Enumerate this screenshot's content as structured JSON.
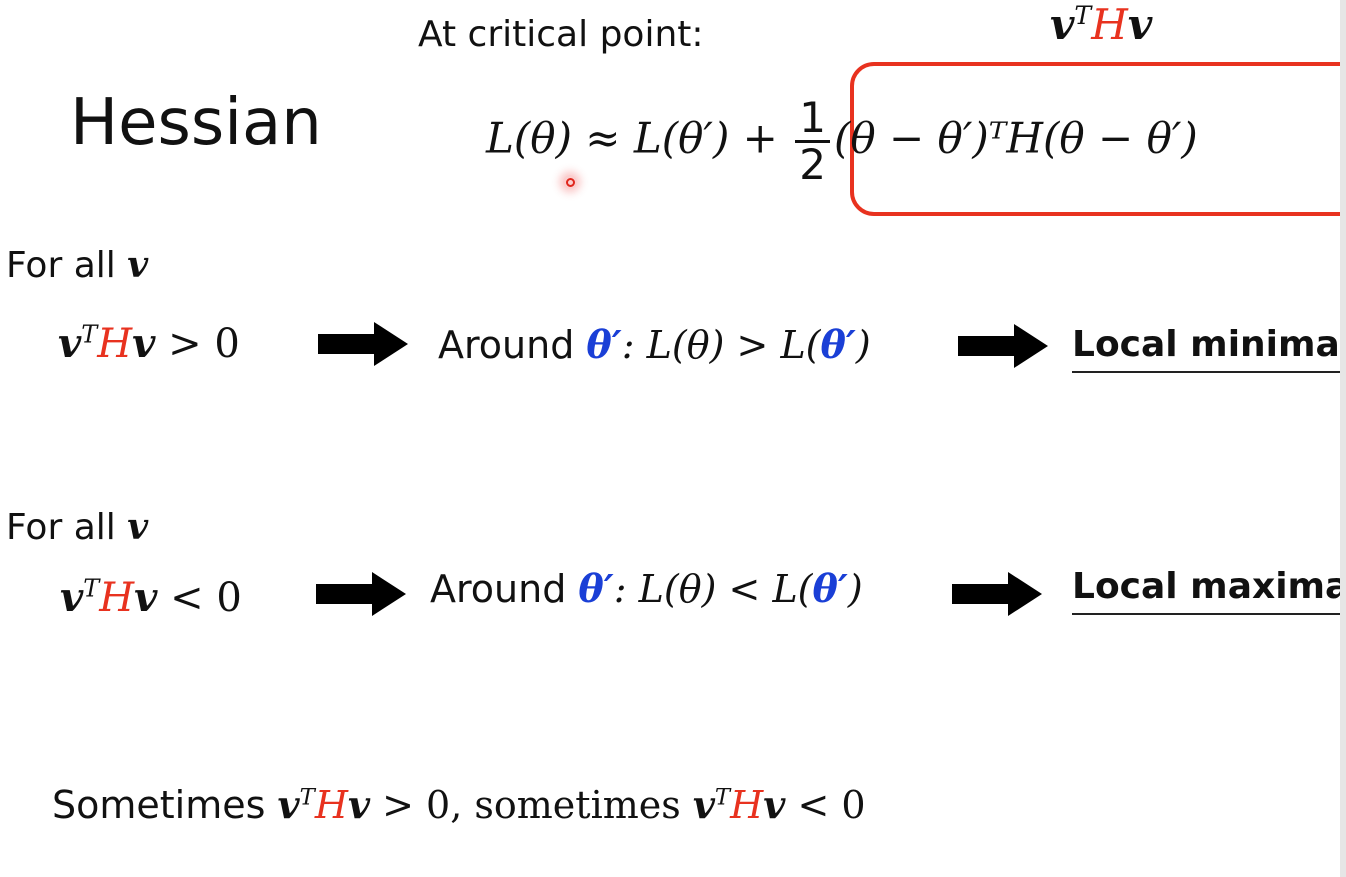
{
  "title": "Hessian",
  "critical_label": "At critical point:",
  "quad_form": {
    "v": "v",
    "T": "T",
    "H": "H"
  },
  "taylor": {
    "lhs": "L(θ)",
    "approx": " ≈ L(θ′) + ",
    "half_num": "1",
    "half_den": "2",
    "quad": "(θ − θ′)ᵀH(θ − θ′)"
  },
  "rows": [
    {
      "forall": "For all",
      "rel": "> 0",
      "around": "Around",
      "theta_prime": "θ′",
      "cond": ": L(θ) > L(",
      "close": ")",
      "result": "Local minima"
    },
    {
      "forall": "For all",
      "rel": "< 0",
      "around": "Around",
      "theta_prime": "θ′",
      "cond": ": L(θ) < L(",
      "close": ")",
      "result": "Local maxima"
    }
  ],
  "bottom": {
    "sometimes1": "Sometimes",
    "gt": " > 0, sometimes ",
    "lt": " < 0"
  },
  "colors": {
    "accent_blue": "#1a3fd6",
    "accent_red": "#e8321f"
  }
}
